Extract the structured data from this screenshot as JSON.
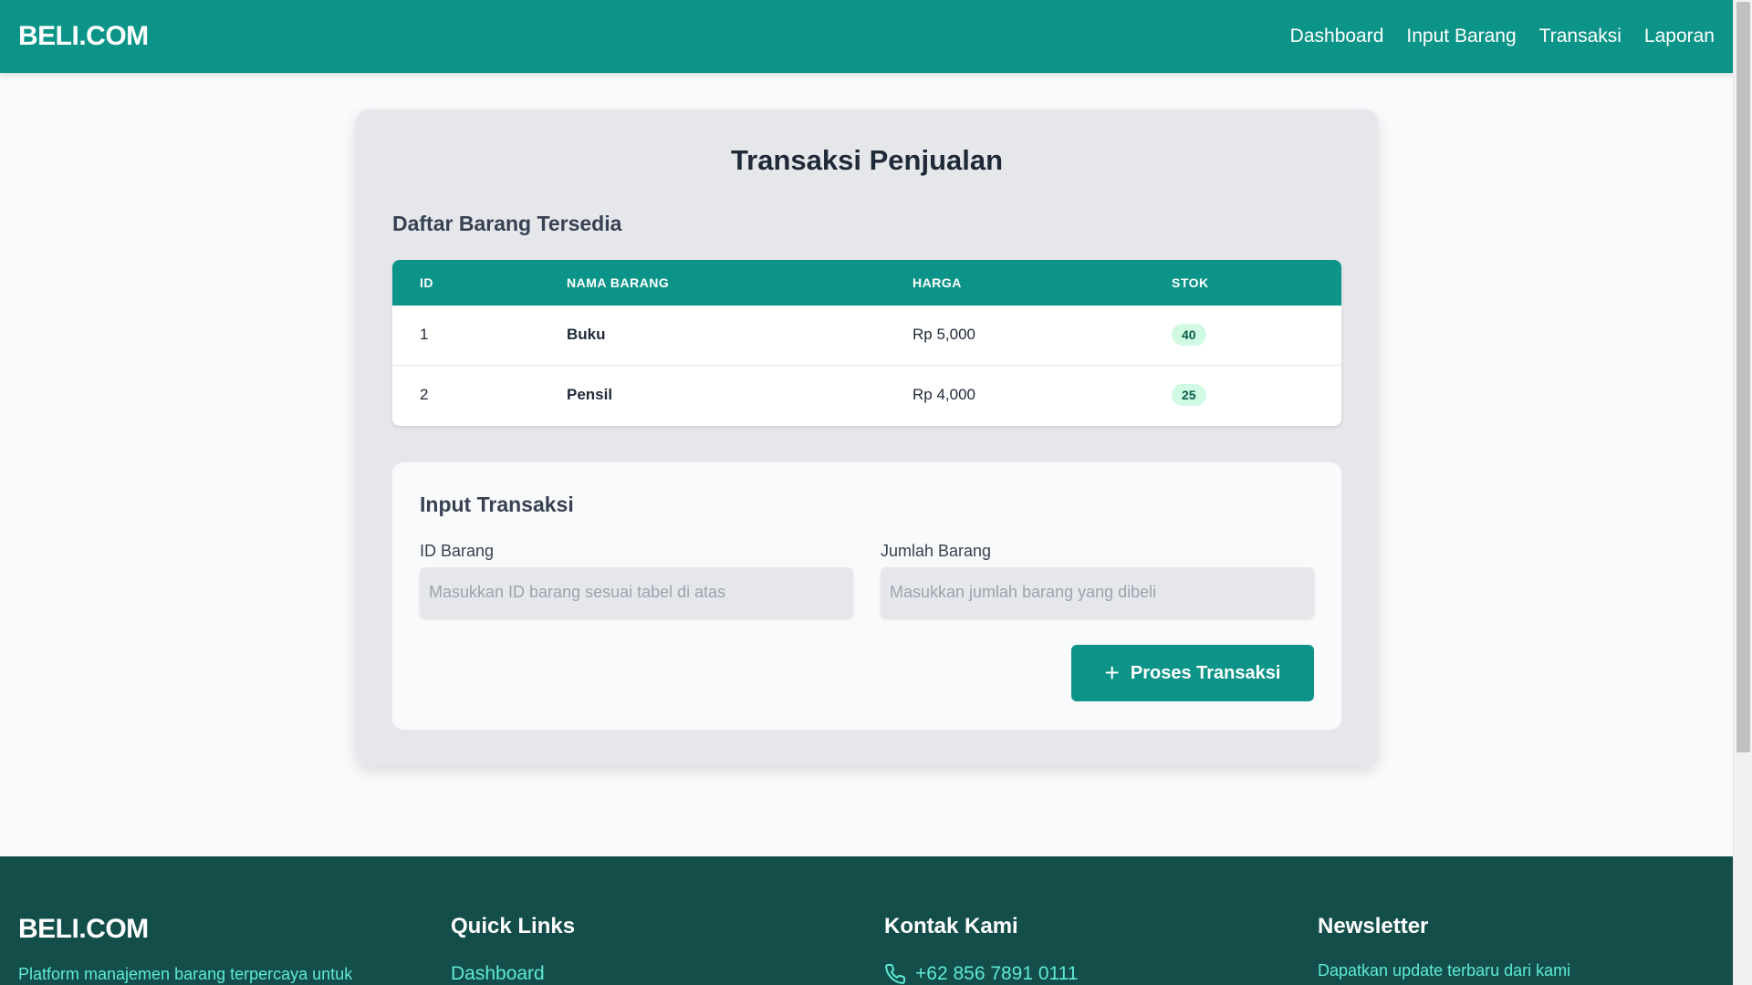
{
  "nav": {
    "brand": "BELI.COM",
    "links": [
      "Dashboard",
      "Input Barang",
      "Transaksi",
      "Laporan"
    ]
  },
  "page": {
    "title": "Transaksi Penjualan",
    "table_section_title": "Daftar Barang Tersedia"
  },
  "table": {
    "headers": [
      "ID",
      "NAMA BARANG",
      "HARGA",
      "STOK"
    ],
    "rows": [
      {
        "id": "1",
        "name": "Buku",
        "price": "Rp 5,000",
        "stock": "40"
      },
      {
        "id": "2",
        "name": "Pensil",
        "price": "Rp 4,000",
        "stock": "25"
      }
    ]
  },
  "form": {
    "title": "Input Transaksi",
    "id_label": "ID Barang",
    "id_value": "",
    "id_placeholder": "Masukkan ID barang sesuai tabel di atas",
    "qty_label": "Jumlah Barang",
    "qty_value": "",
    "qty_placeholder": "Masukkan jumlah barang yang dibeli",
    "submit_label": "Proses Transaksi",
    "submit_icon": "plus-icon"
  },
  "footer": {
    "brand": "BELI.COM",
    "tagline": "Platform manajemen barang terpercaya untuk",
    "quick_links_title": "Quick Links",
    "quick_links": [
      "Dashboard"
    ],
    "contact_title": "Kontak Kami",
    "phone": "+62 856 7891 0111",
    "phone_icon": "phone-icon",
    "newsletter_title": "Newsletter",
    "newsletter_text": "Dapatkan update terbaru dari kami"
  },
  "colors": {
    "primary": "#0d9488",
    "footer_bg": "#134e4a",
    "footer_accent": "#5eead4",
    "badge_bg": "#d1fae5",
    "badge_text": "#065f46"
  }
}
